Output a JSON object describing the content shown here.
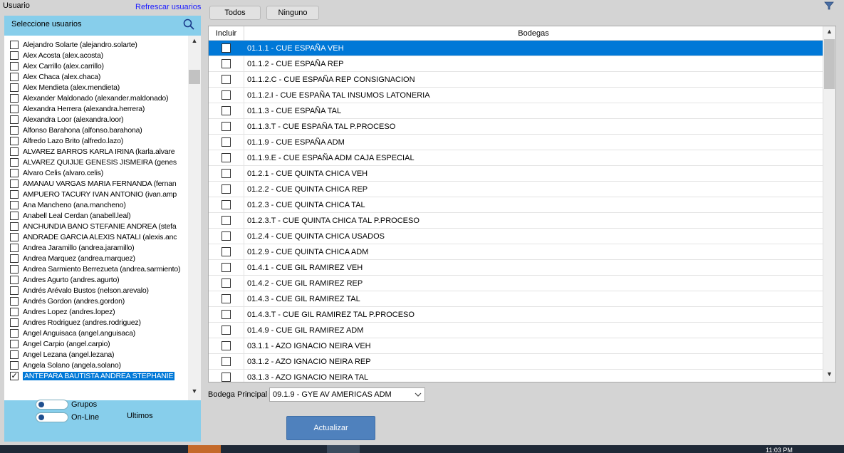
{
  "left_panel": {
    "title": "Usuario",
    "refresh_link": "Refrescar usuarios",
    "search_label": "Seleccione usuarios",
    "users": [
      {
        "label": "Alejandro Solarte (alejandro.solarte)",
        "checked": false
      },
      {
        "label": "Alex Acosta (alex.acosta)",
        "checked": false
      },
      {
        "label": "Alex Carrillo (alex.carrillo)",
        "checked": false
      },
      {
        "label": "Alex Chaca (alex.chaca)",
        "checked": false
      },
      {
        "label": "Alex Mendieta (alex.mendieta)",
        "checked": false
      },
      {
        "label": "Alexander Maldonado (alexander.maldonado)",
        "checked": false
      },
      {
        "label": "Alexandra Herrera (alexandra.herrera)",
        "checked": false
      },
      {
        "label": "Alexandra Loor (alexandra.loor)",
        "checked": false
      },
      {
        "label": "Alfonso Barahona (alfonso.barahona)",
        "checked": false
      },
      {
        "label": "Alfredo Lazo Brito (alfredo.lazo)",
        "checked": false
      },
      {
        "label": "ALVAREZ BARROS KARLA IRINA (karla.alvare",
        "checked": false
      },
      {
        "label": "ALVAREZ QUIJIJE GENESIS JISMEIRA (genes",
        "checked": false
      },
      {
        "label": "Alvaro Celis (alvaro.celis)",
        "checked": false
      },
      {
        "label": "AMANAU VARGAS MARIA FERNANDA (fernan",
        "checked": false
      },
      {
        "label": "AMPUERO TACURY IVAN ANTONIO (ivan.amp",
        "checked": false
      },
      {
        "label": "Ana Mancheno (ana.mancheno)",
        "checked": false
      },
      {
        "label": "Anabell Leal Cerdan (anabell.leal)",
        "checked": false
      },
      {
        "label": "ANCHUNDIA BANO STEFANIE ANDREA (stefa",
        "checked": false
      },
      {
        "label": "ANDRADE GARCIA ALEXIS NATALI (alexis.anc",
        "checked": false
      },
      {
        "label": "Andrea Jaramillo (andrea.jaramillo)",
        "checked": false
      },
      {
        "label": "Andrea Marquez (andrea.marquez)",
        "checked": false
      },
      {
        "label": "Andrea Sarmiento Berrezueta (andrea.sarmiento)",
        "checked": false
      },
      {
        "label": "Andres Agurto (andres.agurto)",
        "checked": false
      },
      {
        "label": "Andrés Arévalo Bustos (nelson.arevalo)",
        "checked": false
      },
      {
        "label": "Andrés Gordon (andres.gordon)",
        "checked": false
      },
      {
        "label": "Andres Lopez (andres.lopez)",
        "checked": false
      },
      {
        "label": "Andres Rodriguez (andres.rodriguez)",
        "checked": false
      },
      {
        "label": "Angel Anguisaca (angel.anguisaca)",
        "checked": false
      },
      {
        "label": "Angel Carpio (angel.carpio)",
        "checked": false
      },
      {
        "label": "Angel Lezana (angel.lezana)",
        "checked": false
      },
      {
        "label": "Angela Solano (angela.solano)",
        "checked": false
      },
      {
        "label": "ANTEPARA BAUTISTA ANDREA STEPHANIE",
        "checked": true,
        "selected": true
      }
    ],
    "toggle_grupos": "Grupos",
    "toggle_online": "On-Line",
    "ultimos": "Ultimos"
  },
  "toolbar": {
    "todos_label": "Todos",
    "ninguno_label": "Ninguno"
  },
  "grid": {
    "col_incluir": "Incluir",
    "col_bodegas": "Bodegas",
    "rows": [
      {
        "label": "01.1.1 - CUE ESPAÑA VEH",
        "selected": true
      },
      {
        "label": "01.1.2 - CUE ESPAÑA REP"
      },
      {
        "label": "01.1.2.C - CUE ESPAÑA REP CONSIGNACION"
      },
      {
        "label": "01.1.2.I - CUE ESPAÑA TAL INSUMOS LATONERIA"
      },
      {
        "label": "01.1.3 - CUE ESPAÑA TAL"
      },
      {
        "label": "01.1.3.T - CUE ESPAÑA TAL P.PROCESO"
      },
      {
        "label": "01.1.9 - CUE ESPAÑA ADM"
      },
      {
        "label": "01.1.9.E - CUE ESPAÑA ADM CAJA ESPECIAL"
      },
      {
        "label": "01.2.1 - CUE QUINTA CHICA VEH"
      },
      {
        "label": "01.2.2 - CUE QUINTA CHICA REP"
      },
      {
        "label": "01.2.3 - CUE QUINTA CHICA TAL"
      },
      {
        "label": "01.2.3.T - CUE QUINTA CHICA TAL P.PROCESO"
      },
      {
        "label": "01.2.4 - CUE QUINTA CHICA USADOS"
      },
      {
        "label": "01.2.9 - CUE QUINTA CHICA ADM"
      },
      {
        "label": "01.4.1 - CUE GIL RAMIREZ VEH"
      },
      {
        "label": "01.4.2 - CUE GIL RAMIREZ REP"
      },
      {
        "label": "01.4.3 - CUE GIL RAMIREZ TAL"
      },
      {
        "label": "01.4.3.T - CUE GIL RAMIREZ TAL P.PROCESO"
      },
      {
        "label": "01.4.9 - CUE GIL RAMIREZ ADM"
      },
      {
        "label": "03.1.1 - AZO IGNACIO NEIRA VEH"
      },
      {
        "label": "03.1.2 - AZO IGNACIO NEIRA REP"
      },
      {
        "label": "03.1.3 - AZO IGNACIO NEIRA TAL"
      }
    ]
  },
  "bodega_principal": {
    "label": "Bodega Principal",
    "value": "09.1.9 - GYE AV AMERICAS ADM"
  },
  "actions": {
    "actualizar_label": "Actualizar"
  },
  "taskbar": {
    "clock": "11:03 PM"
  },
  "colors": {
    "panel_bg": "#87ceeb",
    "selection": "#0078d7",
    "primary_button": "#4f81bd",
    "link": "#1a1aff"
  }
}
